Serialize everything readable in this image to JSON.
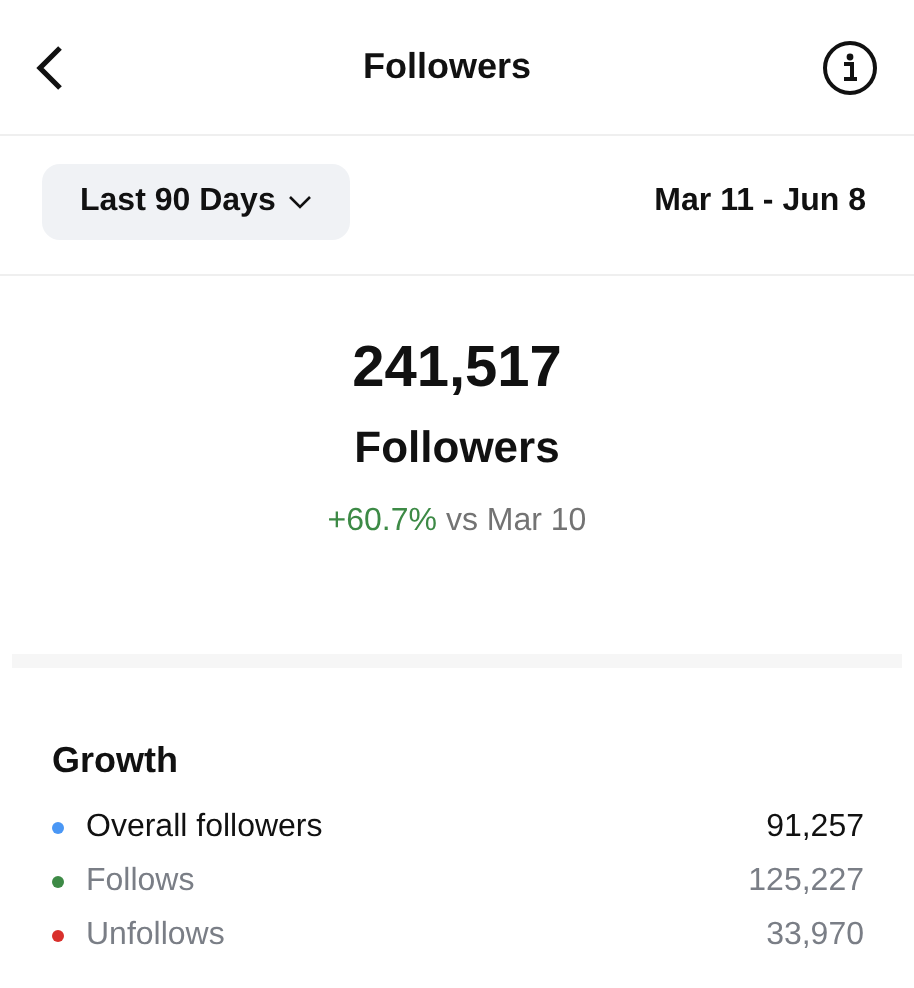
{
  "header": {
    "title": "Followers"
  },
  "range": {
    "label": "Last 90 Days",
    "dates": "Mar 11 - Jun 8"
  },
  "summary": {
    "total": "241,517",
    "label": "Followers",
    "change": "+60.7%",
    "comparison": "vs Mar 10"
  },
  "growth": {
    "title": "Growth",
    "rows": [
      {
        "label": "Overall followers",
        "value": "91,257",
        "color": "#4a97f5",
        "selected": true
      },
      {
        "label": "Follows",
        "value": "125,227",
        "color": "#3d8a46",
        "selected": false
      },
      {
        "label": "Unfollows",
        "value": "33,970",
        "color": "#d9302c",
        "selected": false
      }
    ]
  }
}
